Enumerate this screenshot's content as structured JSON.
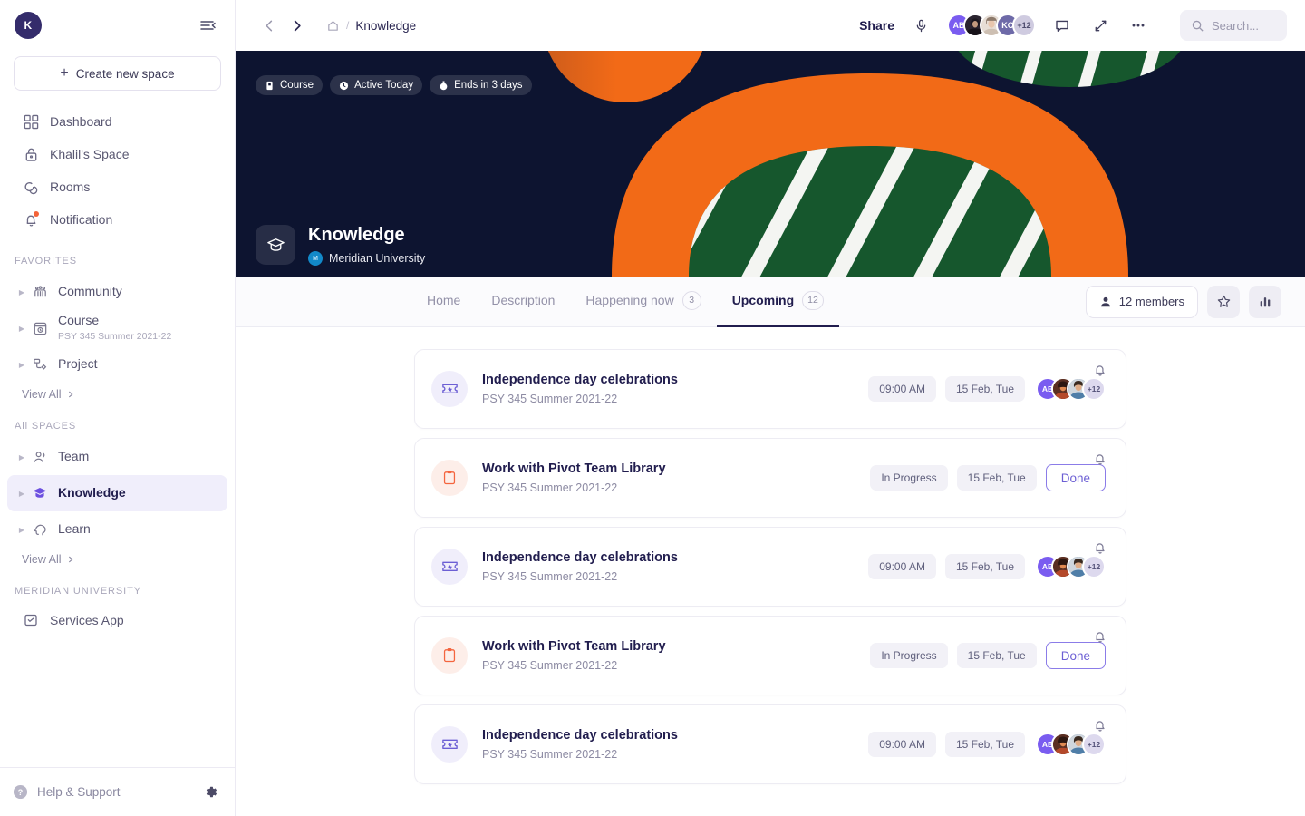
{
  "sidebar": {
    "user_initial": "K",
    "collapse_label": "collapse-sidebar",
    "create_label": "Create new space",
    "nav": [
      {
        "label": "Dashboard",
        "icon": "grid-icon"
      },
      {
        "label": "Khalil's Space",
        "icon": "lock-icon"
      },
      {
        "label": "Rooms",
        "icon": "chat-icon"
      },
      {
        "label": "Notification",
        "icon": "bell-icon"
      }
    ],
    "favorites_label": "FAVORITES",
    "favorites": [
      {
        "name": "Community",
        "sub": "",
        "icon": "people-icon"
      },
      {
        "name": "Course",
        "sub": "PSY 345 Summer 2021-22",
        "icon": "calendar-clock-icon"
      },
      {
        "name": "Project",
        "sub": "",
        "icon": "workflow-icon"
      }
    ],
    "favorites_view_all": "View All",
    "all_spaces_label": "All SPACES",
    "all_spaces": [
      {
        "name": "Team",
        "sub": "",
        "icon": "users-icon",
        "active": false
      },
      {
        "name": "Knowledge",
        "sub": "",
        "icon": "graduation-cap-icon",
        "active": true
      },
      {
        "name": "Learn",
        "sub": "",
        "icon": "head-idea-icon",
        "active": false
      }
    ],
    "all_spaces_view_all": "View All",
    "org_label": "MERIDIAN UNIVERSITY",
    "org_items": [
      {
        "name": "Services App",
        "icon": "app-check-icon"
      }
    ],
    "help_label": "Help & Support",
    "settings_label": "settings"
  },
  "topbar": {
    "back_label": "back",
    "forward_label": "forward",
    "home_label": "home",
    "breadcrumb_separator": "/",
    "breadcrumb_current": "Knowledge",
    "share_label": "Share",
    "mic_label": "microphone",
    "avatars": [
      {
        "initials": "AB",
        "color": "#7a5cf0",
        "photo": false
      },
      {
        "initials": "",
        "color": "#3b3340",
        "photo": true
      },
      {
        "initials": "",
        "color": "#d9cfc6",
        "photo": true
      },
      {
        "initials": "KO",
        "color": "#6e6aa8",
        "photo": false
      },
      {
        "initials": "+12",
        "color": "#cfcbe0",
        "photo": false
      }
    ],
    "comment_label": "comments",
    "expand_label": "expand",
    "more_label": "more options",
    "search_placeholder": "Search..."
  },
  "hero": {
    "badges": [
      {
        "label": "Course",
        "icon": "book-icon"
      },
      {
        "label": "Active Today",
        "icon": "clock-icon"
      },
      {
        "label": "Ends in 3 days",
        "icon": "timer-icon"
      }
    ],
    "title": "Knowledge",
    "university": "Meridian University",
    "space_icon": "graduation-cap-icon",
    "bg_color": "#0d1430",
    "accent_orange": "#f26a17",
    "accent_green": "#16572d"
  },
  "tabs": [
    {
      "label": "Home",
      "count": "",
      "active": false
    },
    {
      "label": "Description",
      "count": "",
      "active": false
    },
    {
      "label": "Happening now",
      "count": "3",
      "active": false
    },
    {
      "label": "Upcoming",
      "count": "12",
      "active": true
    }
  ],
  "tab_actions": {
    "members_label": "12 members",
    "star_label": "favorite",
    "chart_label": "analytics"
  },
  "cards": [
    {
      "type": "event",
      "icon": "ticket-star-icon",
      "title": "Independence day celebrations",
      "subtitle": "PSY 345 Summer 2021-22",
      "pills": [
        "09:00 AM",
        "15 Feb, Tue"
      ],
      "action": "",
      "avatars": [
        {
          "initials": "AB",
          "color": "#7a5cf0",
          "photo": false
        },
        {
          "initials": "",
          "color": "#6b3a2a",
          "photo": true
        },
        {
          "initials": "",
          "color": "#4a6e95",
          "photo": true
        },
        {
          "initials": "+12",
          "color": "#ddd9ee",
          "photo": false
        }
      ]
    },
    {
      "type": "task",
      "icon": "clipboard-icon",
      "title": "Work with Pivot Team Library",
      "subtitle": "PSY 345 Summer 2021-22",
      "pills": [
        "In Progress",
        "15 Feb, Tue"
      ],
      "action": "Done",
      "avatars": []
    },
    {
      "type": "event",
      "icon": "ticket-star-icon",
      "title": "Independence day celebrations",
      "subtitle": "PSY 345 Summer 2021-22",
      "pills": [
        "09:00 AM",
        "15 Feb, Tue"
      ],
      "action": "",
      "avatars": [
        {
          "initials": "AB",
          "color": "#7a5cf0",
          "photo": false
        },
        {
          "initials": "",
          "color": "#6b3a2a",
          "photo": true
        },
        {
          "initials": "",
          "color": "#4a6e95",
          "photo": true
        },
        {
          "initials": "+12",
          "color": "#ddd9ee",
          "photo": false
        }
      ]
    },
    {
      "type": "task",
      "icon": "clipboard-icon",
      "title": "Work with Pivot Team Library",
      "subtitle": "PSY 345 Summer 2021-22",
      "pills": [
        "In Progress",
        "15 Feb, Tue"
      ],
      "action": "Done",
      "avatars": []
    },
    {
      "type": "event",
      "icon": "ticket-star-icon",
      "title": "Independence day celebrations",
      "subtitle": "PSY 345 Summer 2021-22",
      "pills": [
        "09:00 AM",
        "15 Feb, Tue"
      ],
      "action": "",
      "avatars": [
        {
          "initials": "AB",
          "color": "#7a5cf0",
          "photo": false
        },
        {
          "initials": "",
          "color": "#6b3a2a",
          "photo": true
        },
        {
          "initials": "",
          "color": "#4a6e95",
          "photo": true
        },
        {
          "initials": "+12",
          "color": "#ddd9ee",
          "photo": false
        }
      ]
    }
  ],
  "theme": {
    "accent": "#6c5fd4",
    "text_dark": "#211d4e",
    "text_muted": "#8d8ba3"
  }
}
